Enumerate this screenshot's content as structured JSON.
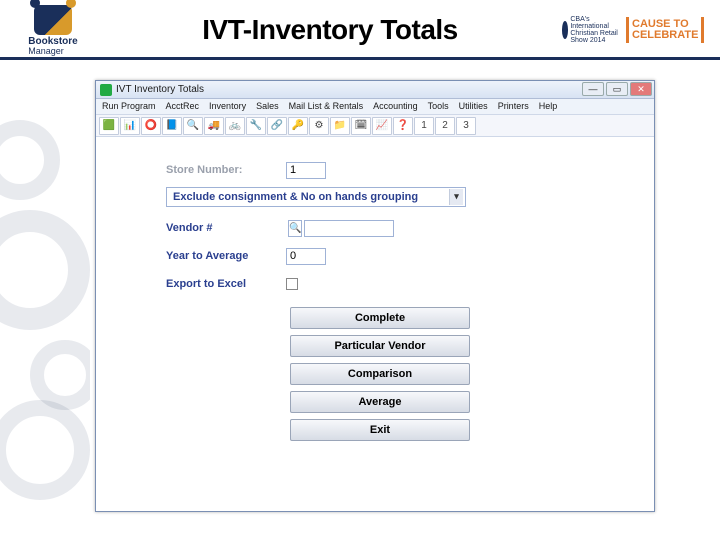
{
  "header": {
    "brand_top": "Bookstore",
    "brand_bottom": "Manager",
    "title": "IVT-Inventory Totals",
    "cba_text": "CBA's International Christian Retail Show 2014",
    "cause_line1": "CAUSE TO",
    "cause_line2": "CELEBRATE"
  },
  "window": {
    "title": "IVT   Inventory Totals",
    "menu": [
      "Run Program",
      "AcctRec",
      "Inventory",
      "Sales",
      "Mail List & Rentals",
      "Accounting",
      "Tools",
      "Utilities",
      "Printers",
      "Help"
    ],
    "toolbar_icons": [
      "🟩",
      "📊",
      "⭕",
      "📘",
      "🔍",
      "🚚",
      "🚲",
      "🔧",
      "🔗",
      "🔑",
      "⚙",
      "📁",
      "🗓",
      "📈",
      "❓"
    ],
    "toolbar_nums": [
      "1",
      "2",
      "3"
    ],
    "labels": {
      "store_number": "Store Number:",
      "dropdown": "Exclude consignment & No on hands grouping",
      "vendor": "Vendor #",
      "year": "Year to Average",
      "export": "Export to Excel"
    },
    "values": {
      "store_number": "1",
      "vendor": "",
      "year": "0"
    },
    "buttons": {
      "complete": "Complete",
      "particular": "Particular Vendor",
      "comparison": "Comparison",
      "average": "Average",
      "exit": "Exit"
    }
  }
}
